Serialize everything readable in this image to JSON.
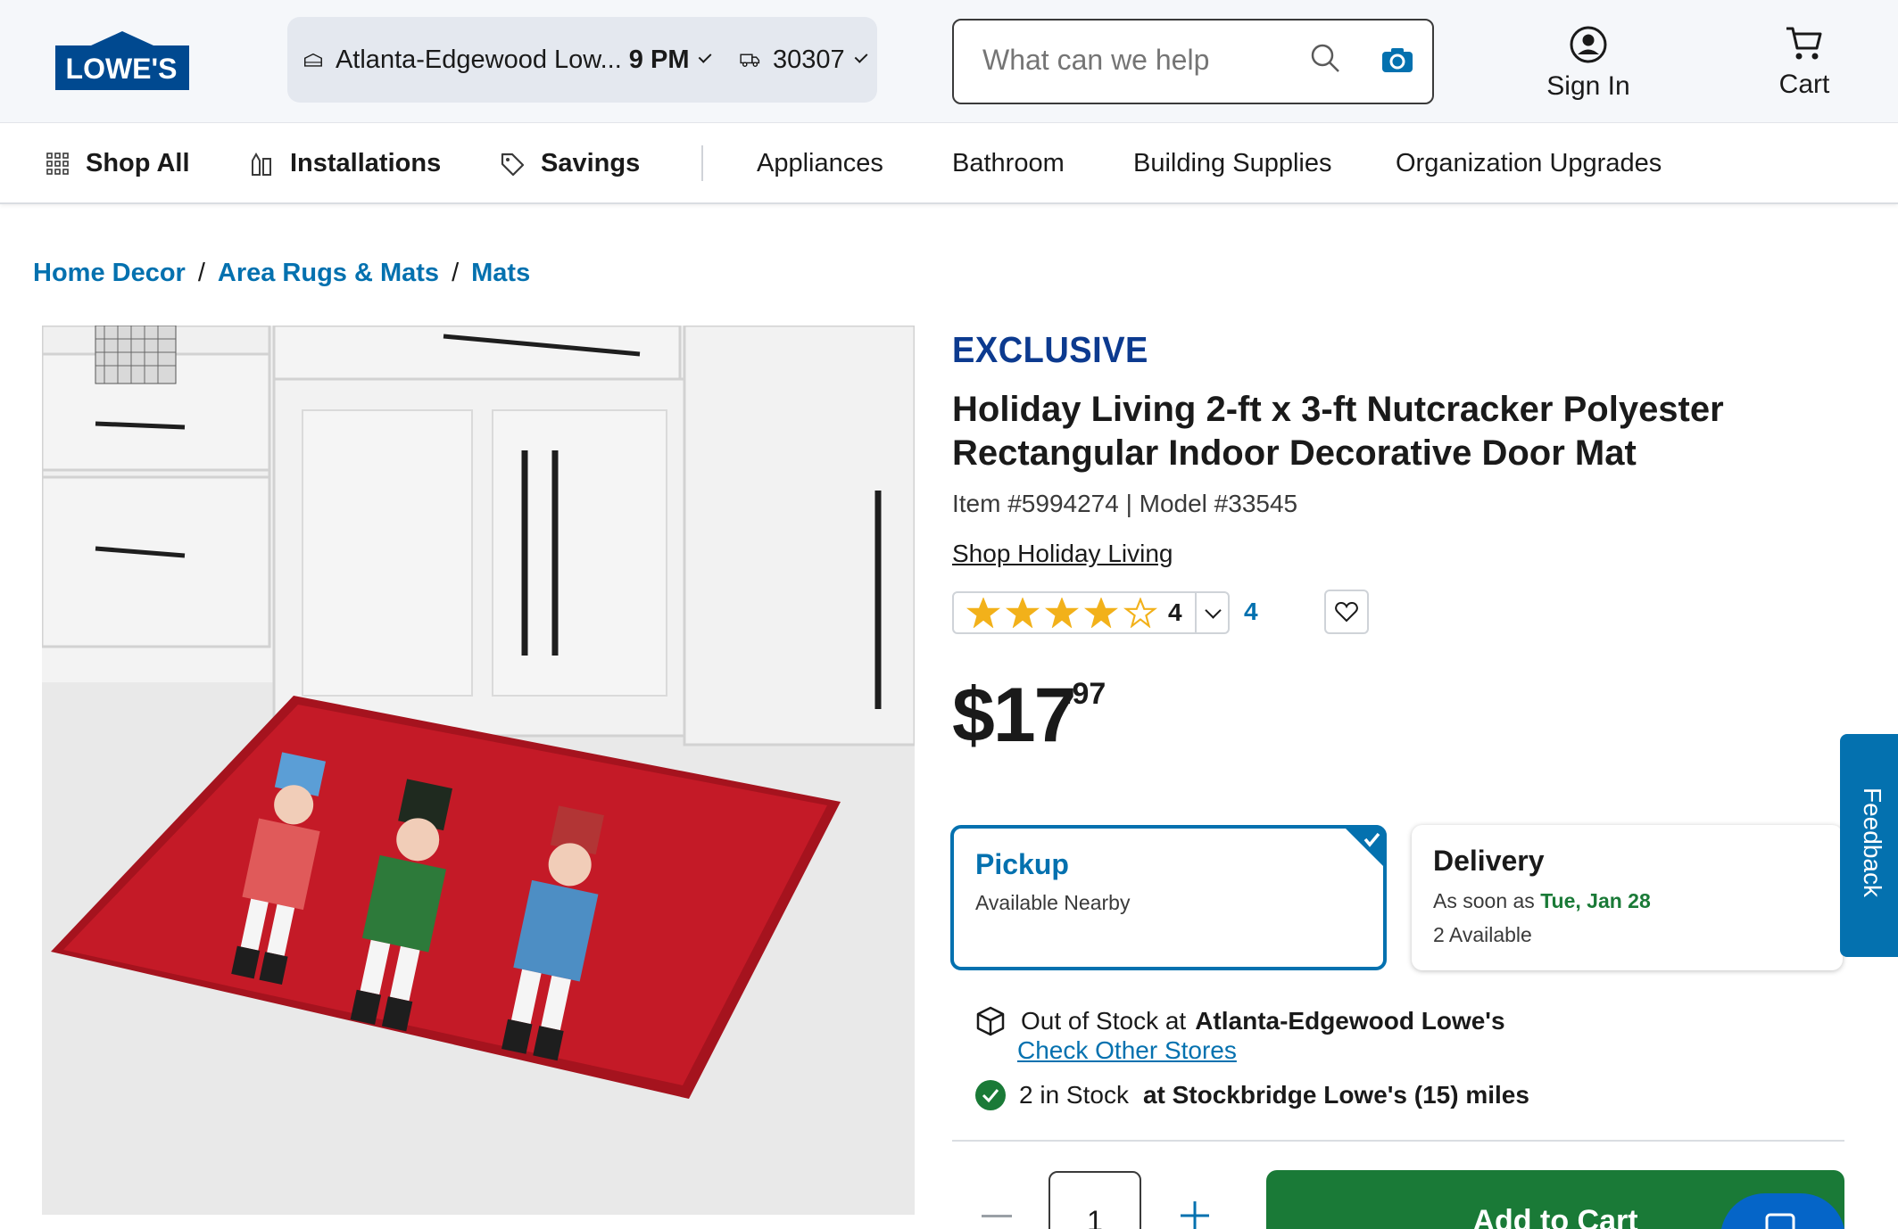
{
  "brand": {
    "logo_text": "LOWE'S",
    "color": "#004990"
  },
  "header": {
    "store_name": "Atlanta-Edgewood Low...",
    "store_hours": "9 PM",
    "zip": "30307",
    "search_placeholder": "What can we help",
    "sign_in": "Sign In",
    "cart": "Cart"
  },
  "nav": {
    "shop_all": "Shop All",
    "installations": "Installations",
    "savings": "Savings",
    "categories": [
      "Appliances",
      "Bathroom",
      "Building Supplies",
      "Organization Upgrades"
    ]
  },
  "breadcrumb": [
    "Home Decor",
    "Area Rugs & Mats",
    "Mats"
  ],
  "breadcrumb_sep": "/",
  "product": {
    "badge": "EXCLUSIVE",
    "title": "Holiday Living 2-ft x 3-ft Nutcracker Polyester Rectangular Indoor Decorative Door Mat",
    "item_model": "Item #5994274 | Model #33545",
    "shop_brand": "Shop Holiday Living",
    "rating": "4",
    "rating_value": 4,
    "rating_max": 5,
    "review_count": "4",
    "price_dollars": "$17",
    "price_cents": ".97"
  },
  "fulfillment": {
    "pickup_title": "Pickup",
    "pickup_sub": "Available Nearby",
    "delivery_title": "Delivery",
    "delivery_prefix": "As soon as",
    "delivery_date": "Tue, Jan 28",
    "delivery_available": "2 Available"
  },
  "stock": {
    "out_prefix": "Out of Stock at",
    "out_store": "Atlanta-Edgewood Lowe's",
    "check_other": "Check Other Stores",
    "in_count": "2 in Stock",
    "in_store": "at Stockbridge Lowe's (15) miles"
  },
  "cart_actions": {
    "quantity": "1",
    "add_to_cart": "Add to Cart"
  },
  "feedback": "Feedback",
  "colors": {
    "link_blue": "#0471af",
    "brand_blue": "#004990",
    "cart_green": "#1a7a37",
    "star_gold": "#f2b11a"
  }
}
